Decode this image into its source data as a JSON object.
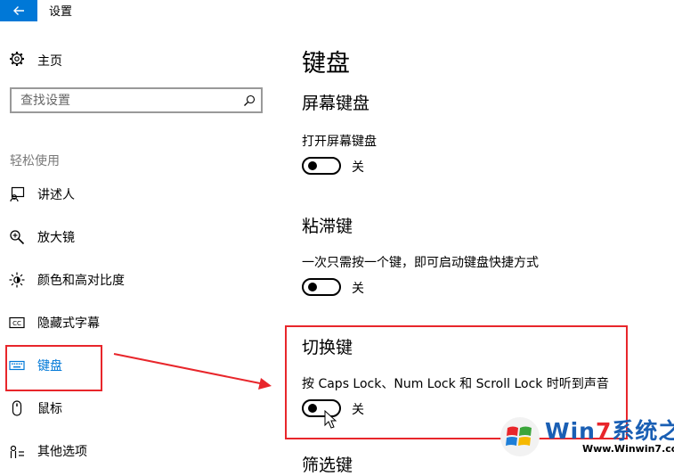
{
  "window": {
    "title": "设置",
    "back_icon": "arrow-left-icon",
    "accent": "#0078d7"
  },
  "sidebar": {
    "home": {
      "label": "主页",
      "icon": "gear-icon"
    },
    "search": {
      "placeholder": "查找设置",
      "icon": "search-icon"
    },
    "group_header": "轻松使用",
    "items": [
      {
        "label": "讲述人",
        "icon": "narrator-icon",
        "selected": false
      },
      {
        "label": "放大镜",
        "icon": "magnifier-icon",
        "selected": false
      },
      {
        "label": "颜色和高对比度",
        "icon": "brightness-icon",
        "selected": false
      },
      {
        "label": "隐藏式字幕",
        "icon": "closed-captions-icon",
        "selected": false
      },
      {
        "label": "键盘",
        "icon": "keyboard-icon",
        "selected": true
      },
      {
        "label": "鼠标",
        "icon": "mouse-icon",
        "selected": false
      },
      {
        "label": "其他选项",
        "icon": "options-icon",
        "selected": false
      }
    ]
  },
  "main": {
    "title": "键盘",
    "sections": [
      {
        "heading": "屏幕键盘",
        "label": "打开屏幕键盘",
        "state": "关",
        "on": false
      },
      {
        "heading": "粘滞键",
        "label": "一次只需按一个键，即可启动键盘快捷方式",
        "state": "关",
        "on": false
      },
      {
        "heading": "切换键",
        "label": "按 Caps Lock、Num Lock 和 Scroll Lock 时听到声音",
        "state": "关",
        "on": false
      },
      {
        "heading": "筛选键"
      }
    ]
  },
  "annotation": {
    "color": "#e8262b"
  },
  "watermark": {
    "brand_prefix": "Win",
    "brand_seven": "7",
    "brand_suffix": "系统之家",
    "url": "Www.Winwin7.com"
  }
}
